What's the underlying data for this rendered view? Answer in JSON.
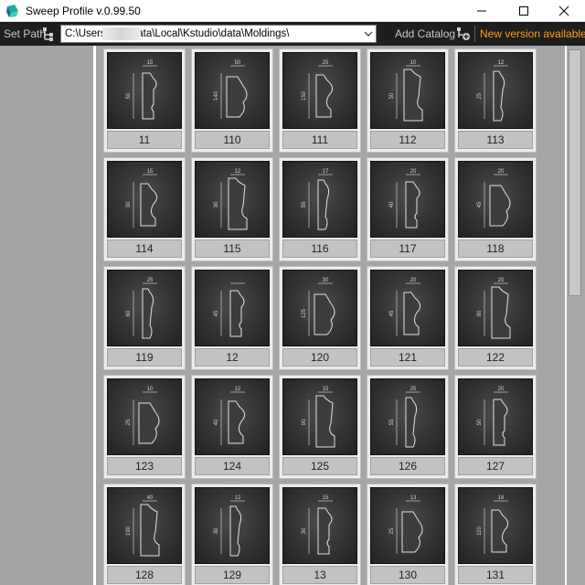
{
  "window": {
    "title": "Sweep Profile v.0.99.50",
    "app_icon": "sweep-profile-logo-icon"
  },
  "toolbar": {
    "set_path_label": "Set Path",
    "set_path_icon": "folder-tree-icon",
    "path_value": "C:\\Users\\          AppData\\Local\\Kstudio\\data\\Moldings\\",
    "add_catalog_label": "Add Catalog",
    "add_catalog_icon": "add-catalog-icon",
    "new_version_label": "New version available",
    "new_version_color": "#ff9c1c"
  },
  "catalog": {
    "items": [
      {
        "label": "11",
        "dims": [
          "15",
          "50"
        ]
      },
      {
        "label": "110",
        "dims": [
          "50",
          "140"
        ]
      },
      {
        "label": "111",
        "dims": [
          "25",
          "150"
        ]
      },
      {
        "label": "112",
        "dims": [
          "10",
          "50"
        ]
      },
      {
        "label": "113",
        "dims": [
          "12",
          "25"
        ]
      },
      {
        "label": "114",
        "dims": [
          "15",
          "30"
        ]
      },
      {
        "label": "115",
        "dims": [
          "12",
          "30"
        ]
      },
      {
        "label": "116",
        "dims": [
          "17",
          "55"
        ]
      },
      {
        "label": "117",
        "dims": [
          "20",
          "40"
        ]
      },
      {
        "label": "118",
        "dims": [
          "20",
          "45"
        ]
      },
      {
        "label": "119",
        "dims": [
          "25",
          "60"
        ]
      },
      {
        "label": "12",
        "dims": [
          "",
          "45"
        ]
      },
      {
        "label": "120",
        "dims": [
          "30",
          "125"
        ]
      },
      {
        "label": "121",
        "dims": [
          "20",
          "45"
        ]
      },
      {
        "label": "122",
        "dims": [
          "20",
          "80"
        ]
      },
      {
        "label": "123",
        "dims": [
          "10",
          "25"
        ]
      },
      {
        "label": "124",
        "dims": [
          "12",
          "40"
        ]
      },
      {
        "label": "125",
        "dims": [
          "15",
          "90"
        ]
      },
      {
        "label": "126",
        "dims": [
          "25",
          "55"
        ]
      },
      {
        "label": "127",
        "dims": [
          "20",
          "50"
        ]
      },
      {
        "label": "128",
        "dims": [
          "40",
          "190"
        ]
      },
      {
        "label": "129",
        "dims": [
          "12",
          "30"
        ]
      },
      {
        "label": "13",
        "dims": [
          "15",
          "30"
        ]
      },
      {
        "label": "130",
        "dims": [
          "13",
          "25"
        ]
      },
      {
        "label": "131",
        "dims": [
          "18",
          "110"
        ]
      }
    ]
  }
}
